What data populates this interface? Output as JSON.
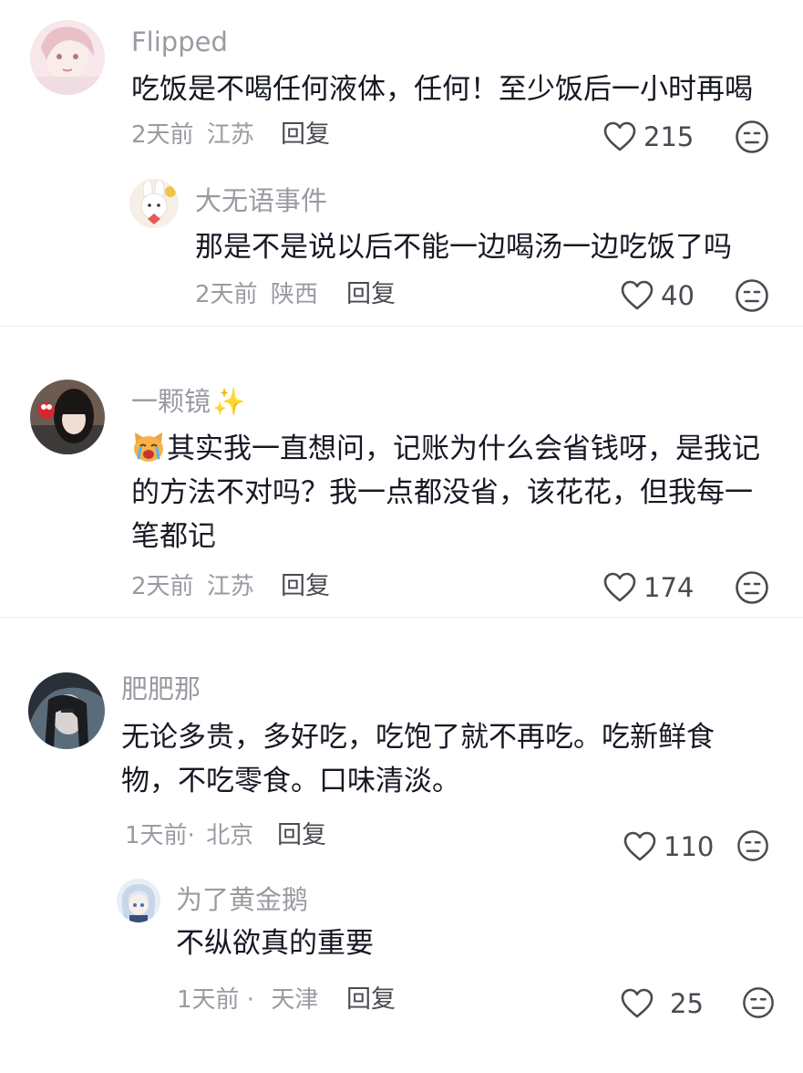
{
  "comments": [
    {
      "username": "Flipped",
      "text_lines": [
        "吃饭是不喝任何液体，任何！至少饭后一小时再喝"
      ],
      "time": "2天前",
      "location": "江苏",
      "reply_label": "回复",
      "likes": "215",
      "replies": [
        {
          "username": "大无语事件",
          "text_lines": [
            "那是不是说以后不能一边喝汤一边吃饭了吗"
          ],
          "time": "2天前",
          "location": "陕西",
          "reply_label": "回复",
          "likes": "40"
        }
      ]
    },
    {
      "username": "一颗镜",
      "username_emoji": "✨",
      "text_lines": [
        "其实我一直想问，记账为什么会省钱呀，是我记",
        "的方法不对吗？我一点都没省，该花花，但我每一",
        "笔都记"
      ],
      "time": "2天前",
      "location": "江苏",
      "reply_label": "回复",
      "likes": "174"
    },
    {
      "username": "肥肥那",
      "text_lines": [
        "无论多贵，多好吃，吃饱了就不再吃。吃新鲜食",
        "物，不吃零食。口味清淡。"
      ],
      "time": "1天前·",
      "location": "北京",
      "reply_label": "回复",
      "likes": "110",
      "replies": [
        {
          "username": "为了黄金鹅",
          "text_lines": [
            "不纵欲真的重要"
          ],
          "time": "1天前 ·",
          "location": "天津",
          "reply_label": "回复",
          "likes": "25"
        }
      ]
    }
  ],
  "icons": {
    "like": "heart-outline-icon",
    "dislike": "neutral-face-icon",
    "text_emoji": "crying-cat-sticker"
  },
  "colors": {
    "text": "#161823",
    "secondary": "#9a9aa2",
    "action": "#4a4a52"
  }
}
